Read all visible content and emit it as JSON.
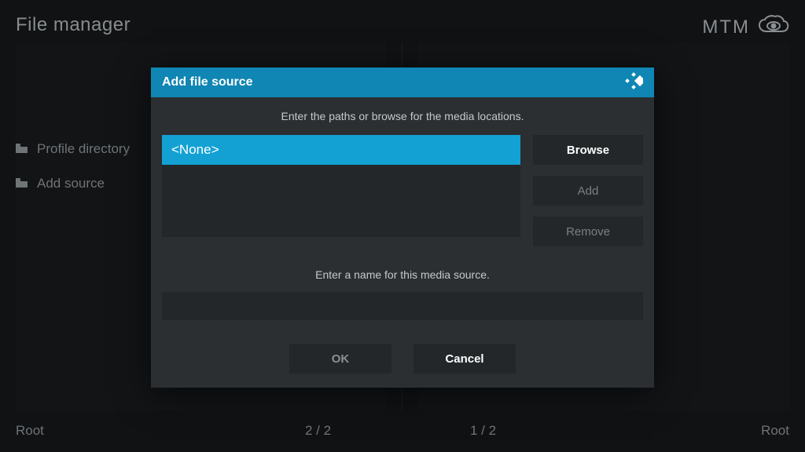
{
  "header": {
    "title": "File manager",
    "brand_text": "MTM"
  },
  "sidebar": {
    "items": [
      {
        "label": "Profile directory"
      },
      {
        "label": "Add source"
      }
    ]
  },
  "dialog": {
    "title": "Add file source",
    "prompt_paths": "Enter the paths or browse for the media locations.",
    "path_value": "<None>",
    "browse_label": "Browse",
    "add_label": "Add",
    "remove_label": "Remove",
    "prompt_name": "Enter a name for this media source.",
    "name_value": "",
    "ok_label": "OK",
    "cancel_label": "Cancel"
  },
  "footer": {
    "root_left": "Root",
    "left_count": "2 / 2",
    "right_count": "1 / 2",
    "root_right": "Root"
  }
}
